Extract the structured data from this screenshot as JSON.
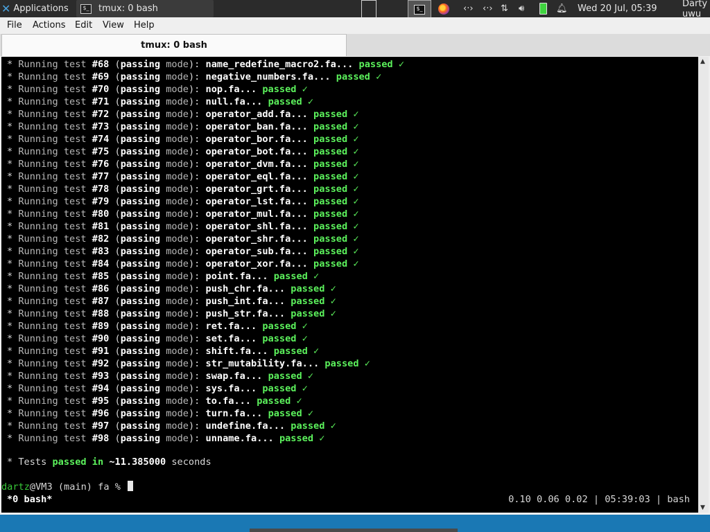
{
  "panel": {
    "applications_label": "Applications",
    "task_label": "tmux: 0 bash",
    "clock": "Wed 20 Jul, 05:39",
    "user": "Darty uwu"
  },
  "window": {
    "menus": [
      "File",
      "Actions",
      "Edit",
      "View",
      "Help"
    ],
    "tab_title": "tmux: 0 bash"
  },
  "terminal": {
    "line_prefix": "Running test",
    "mode_text": "passing",
    "mode_word": "mode",
    "passed_word": "passed",
    "check": "✓",
    "tests": [
      {
        "num": "#68",
        "file": "name_redefine_macro2.fa"
      },
      {
        "num": "#69",
        "file": "negative_numbers.fa"
      },
      {
        "num": "#70",
        "file": "nop.fa"
      },
      {
        "num": "#71",
        "file": "null.fa"
      },
      {
        "num": "#72",
        "file": "operator_add.fa"
      },
      {
        "num": "#73",
        "file": "operator_ban.fa"
      },
      {
        "num": "#74",
        "file": "operator_bor.fa"
      },
      {
        "num": "#75",
        "file": "operator_bot.fa"
      },
      {
        "num": "#76",
        "file": "operator_dvm.fa"
      },
      {
        "num": "#77",
        "file": "operator_eql.fa"
      },
      {
        "num": "#78",
        "file": "operator_grt.fa"
      },
      {
        "num": "#79",
        "file": "operator_lst.fa"
      },
      {
        "num": "#80",
        "file": "operator_mul.fa"
      },
      {
        "num": "#81",
        "file": "operator_shl.fa"
      },
      {
        "num": "#82",
        "file": "operator_shr.fa"
      },
      {
        "num": "#83",
        "file": "operator_sub.fa"
      },
      {
        "num": "#84",
        "file": "operator_xor.fa"
      },
      {
        "num": "#85",
        "file": "point.fa"
      },
      {
        "num": "#86",
        "file": "push_chr.fa"
      },
      {
        "num": "#87",
        "file": "push_int.fa"
      },
      {
        "num": "#88",
        "file": "push_str.fa"
      },
      {
        "num": "#89",
        "file": "ret.fa"
      },
      {
        "num": "#90",
        "file": "set.fa"
      },
      {
        "num": "#91",
        "file": "shift.fa"
      },
      {
        "num": "#92",
        "file": "str_mutability.fa"
      },
      {
        "num": "#93",
        "file": "swap.fa"
      },
      {
        "num": "#94",
        "file": "sys.fa"
      },
      {
        "num": "#95",
        "file": "to.fa"
      },
      {
        "num": "#96",
        "file": "turn.fa"
      },
      {
        "num": "#97",
        "file": "undefine.fa"
      },
      {
        "num": "#98",
        "file": "unname.fa"
      }
    ],
    "summary": {
      "tests_word": "Tests",
      "passed_word": "passed",
      "in_word": "in",
      "time": "~11.385000",
      "unit": "seconds"
    },
    "prompt": {
      "user": "dartz",
      "host": "@VM3",
      "branch": "(main)",
      "dir": "fa",
      "symbol": "%"
    }
  },
  "tmux_status": {
    "window_label": "*0 bash*",
    "load": "0.10 0.06 0.02",
    "time": "05:39:03",
    "session": "bash"
  },
  "colors": {
    "terminal_bg": "#000000",
    "passed_green": "#5cf25c",
    "prompt_user_green": "#38c838",
    "desktop_blue": "#1a78b4",
    "panel_bg": "#2b2b2b"
  },
  "icons": [
    "xfce-logo-icon",
    "terminal-icon",
    "workspace-icon",
    "firefox-icon",
    "network-icon",
    "transfer-icon",
    "volume-icon",
    "battery-icon",
    "notification-bell-icon"
  ]
}
